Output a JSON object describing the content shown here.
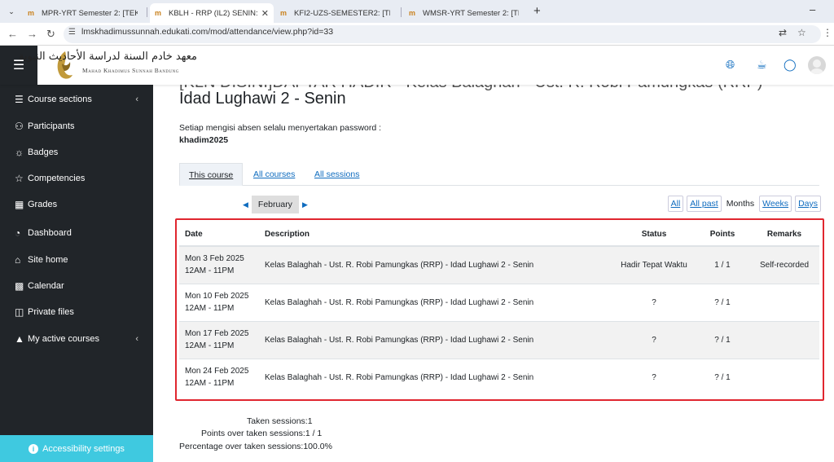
{
  "browser": {
    "tabs": [
      {
        "label": "MPR-YRT Semester 2: [TEKA",
        "active": false
      },
      {
        "label": "KBLH - RRP (IL2) SENIN: [KLN",
        "active": true
      },
      {
        "label": "KFI2-UZS-SEMESTER2: [TEKA",
        "active": false
      },
      {
        "label": "WMSR-YRT Semester 2: [TEK",
        "active": false
      }
    ],
    "url": "lmskhadimussunnah.edukati.com/mod/attendance/view.php?id=33"
  },
  "brand": {
    "arabic": "معهد خادم السنة لدراسة الأحاديث النبوية",
    "english": "Mahad Khadimus Sunnah Bandung"
  },
  "sidebar": {
    "items": [
      {
        "label": "Course sections",
        "icon": "list-icon"
      },
      {
        "label": "Participants",
        "icon": "users-icon"
      },
      {
        "label": "Badges",
        "icon": "badge-icon"
      },
      {
        "label": "Competencies",
        "icon": "star-icon"
      },
      {
        "label": "Grades",
        "icon": "table-icon"
      },
      {
        "label": "Dashboard",
        "icon": "gauge-icon"
      },
      {
        "label": "Site home",
        "icon": "home-icon"
      },
      {
        "label": "Calendar",
        "icon": "calendar-icon"
      },
      {
        "label": "Private files",
        "icon": "file-icon"
      },
      {
        "label": "My active courses",
        "icon": "graduation-cap-icon"
      }
    ],
    "accessibility": "Accessibility settings"
  },
  "page": {
    "title_cut": "[KLN DISINI]DAFTAR HADIR - Kelas Balaghah - Ust. R. Robi Pamungkas (RRP) -",
    "title": "Idad Lughawi 2 - Senin",
    "intro": "Setiap mengisi absen selalu menyertakan password :",
    "password": "khadim2025",
    "course_tabs": [
      "This course",
      "All courses",
      "All sessions"
    ],
    "month": "February",
    "views": {
      "all": "All",
      "all_past": "All past",
      "months": "Months",
      "weeks": "Weeks",
      "days": "Days"
    }
  },
  "table": {
    "headers": {
      "date": "Date",
      "description": "Description",
      "status": "Status",
      "points": "Points",
      "remarks": "Remarks"
    },
    "rows": [
      {
        "date": "Mon 3 Feb 2025",
        "time": "12AM - 11PM",
        "description": "Kelas Balaghah - Ust. R. Robi Pamungkas (RRP) - Idad Lughawi 2 - Senin",
        "status": "Hadir Tepat Waktu",
        "points": "1 / 1",
        "remarks": "Self-recorded"
      },
      {
        "date": "Mon 10 Feb 2025",
        "time": "12AM - 11PM",
        "description": "Kelas Balaghah - Ust. R. Robi Pamungkas (RRP) - Idad Lughawi 2 - Senin",
        "status": "?",
        "points": "? / 1",
        "remarks": ""
      },
      {
        "date": "Mon 17 Feb 2025",
        "time": "12AM - 11PM",
        "description": "Kelas Balaghah - Ust. R. Robi Pamungkas (RRP) - Idad Lughawi 2 - Senin",
        "status": "?",
        "points": "? / 1",
        "remarks": ""
      },
      {
        "date": "Mon 24 Feb 2025",
        "time": "12AM - 11PM",
        "description": "Kelas Balaghah - Ust. R. Robi Pamungkas (RRP) - Idad Lughawi 2 - Senin",
        "status": "?",
        "points": "? / 1",
        "remarks": ""
      }
    ]
  },
  "summary": {
    "taken_label": "Taken sessions:",
    "taken_value": "1",
    "points_label": "Points over taken sessions:",
    "points_value": "1 / 1",
    "pct_label": "Percentage over taken sessions:",
    "pct_value": "100.0%"
  }
}
